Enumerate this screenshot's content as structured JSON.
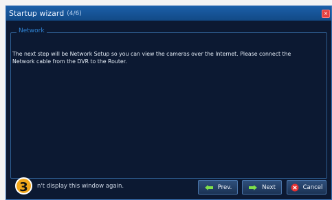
{
  "window": {
    "title": "Startup wizard",
    "step": "(4/6)"
  },
  "network": {
    "legend": "Network",
    "message": "The next step will be Network Setup so you can view the cameras over the Internet. Please connect the Network cable from the DVR to the Router."
  },
  "footer": {
    "badge": "3",
    "dont_show": "n't display this window again."
  },
  "buttons": {
    "prev": "Prev.",
    "next": "Next",
    "cancel": "Cancel"
  },
  "icons": {
    "close": "close-icon",
    "prev": "arrow-left-icon",
    "next": "arrow-right-icon",
    "cancel": "x-icon"
  },
  "colors": {
    "accent": "#1b5fa8",
    "legend": "#2e82d3",
    "badge": "#f3a71b"
  }
}
